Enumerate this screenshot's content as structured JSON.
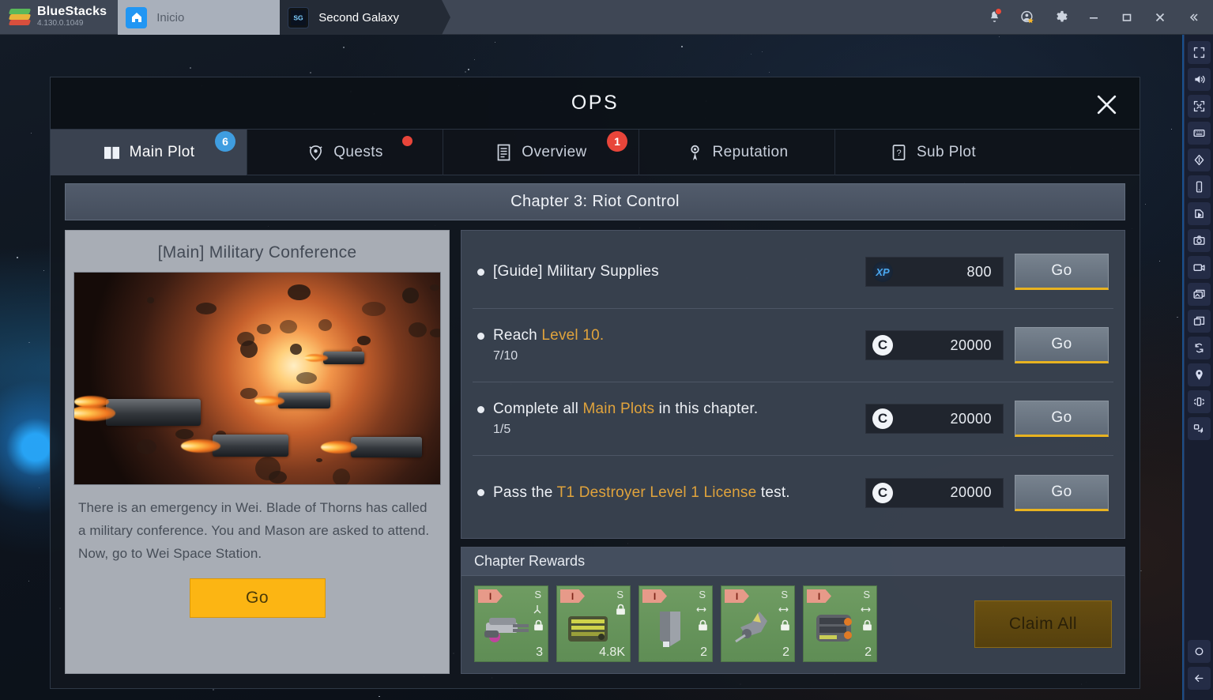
{
  "bluestacks": {
    "brand": "BlueStacks",
    "version": "4.130.0.1049",
    "tabs": [
      {
        "label": "Inicio",
        "icon": "home-icon",
        "active": false
      },
      {
        "label": "Second Galaxy",
        "icon": "game-app-icon",
        "active": true
      }
    ],
    "window_controls": [
      {
        "name": "notifications-bell-icon",
        "glyph": "🔔",
        "has_dot": true
      },
      {
        "name": "account-star-icon",
        "glyph": "★",
        "has_dot": false
      },
      {
        "name": "settings-gear-icon",
        "glyph": "⚙",
        "has_dot": false
      },
      {
        "name": "minimize-button",
        "glyph": "—",
        "has_dot": false
      },
      {
        "name": "maximize-button",
        "glyph": "❐",
        "has_dot": false
      },
      {
        "name": "close-button",
        "glyph": "✕",
        "has_dot": false
      },
      {
        "name": "collapse-button",
        "glyph": "«",
        "has_dot": false
      }
    ]
  },
  "modal": {
    "title": "OPS",
    "close_label": "✕",
    "chapter": "Chapter 3: Riot Control"
  },
  "tabs": [
    {
      "label": "Main Plot",
      "icon": "book-icon",
      "active": true,
      "badge": "6",
      "badge_type": "blue"
    },
    {
      "label": "Quests",
      "icon": "helmet-icon",
      "active": false,
      "badge": "",
      "badge_type": "dot"
    },
    {
      "label": "Overview",
      "icon": "document-icon",
      "active": false,
      "badge": "1",
      "badge_type": "red"
    },
    {
      "label": "Reputation",
      "icon": "medal-icon",
      "active": false,
      "badge": "",
      "badge_type": "none"
    },
    {
      "label": "Sub Plot",
      "icon": "question-icon",
      "active": false,
      "badge": "",
      "badge_type": "none"
    }
  ],
  "mission": {
    "title": "[Main] Military Conference",
    "description": "There is an emergency in Wei. Blade of Thorns has called a military conference. You and Mason are asked to attend. Now, go to Wei Space Station.",
    "go_label": "Go",
    "art_alt": "space-battle-artwork"
  },
  "tasks": [
    {
      "text_prefix": "[Guide] Military Supplies",
      "highlight": "",
      "text_suffix": "",
      "progress": "",
      "reward_icon": "xp",
      "reward_value": "800",
      "action": "Go"
    },
    {
      "text_prefix": "Reach ",
      "highlight": "Level 10.",
      "text_suffix": "",
      "progress": "7/10",
      "reward_icon": "c",
      "reward_value": "20000",
      "action": "Go"
    },
    {
      "text_prefix": "Complete all ",
      "highlight": "Main Plots",
      "text_suffix": " in this chapter.",
      "progress": "1/5",
      "reward_icon": "c",
      "reward_value": "20000",
      "action": "Go"
    },
    {
      "text_prefix": "Pass the ",
      "highlight": "T1 Destroyer Level 1 License",
      "text_suffix": " test.",
      "progress": "",
      "reward_icon": "c",
      "reward_value": "20000",
      "action": "Go"
    }
  ],
  "rewards": {
    "header": "Chapter Rewards",
    "claim_label": "Claim All",
    "items": [
      {
        "rank": "I",
        "grade": "S",
        "qty": "3",
        "locked": true,
        "sub_icon": "antenna-icon",
        "art": "weapon-turret"
      },
      {
        "rank": "I",
        "grade": "S",
        "qty": "4.8K",
        "locked": true,
        "sub_icon": "",
        "art": "ammo-crate"
      },
      {
        "rank": "I",
        "grade": "S",
        "qty": "2",
        "locked": true,
        "sub_icon": "shield-icon",
        "art": "armor-plate"
      },
      {
        "rank": "I",
        "grade": "S",
        "qty": "2",
        "locked": true,
        "sub_icon": "shield-icon",
        "art": "drone-module"
      },
      {
        "rank": "I",
        "grade": "S",
        "qty": "2",
        "locked": true,
        "sub_icon": "shield-icon",
        "art": "engine-module"
      }
    ]
  },
  "sidebar": {
    "items": [
      {
        "name": "fullscreen-icon"
      },
      {
        "name": "volume-icon"
      },
      {
        "name": "resize-icon"
      },
      {
        "name": "keyboard-icon"
      },
      {
        "name": "gamepad-icon"
      },
      {
        "name": "phone-rotate-icon"
      },
      {
        "name": "script-play-icon"
      },
      {
        "name": "screenshot-camera-icon"
      },
      {
        "name": "video-record-icon"
      },
      {
        "name": "media-manager-icon"
      },
      {
        "name": "multi-instance-icon"
      },
      {
        "name": "sync-icon"
      },
      {
        "name": "location-pin-icon"
      },
      {
        "name": "shake-icon"
      },
      {
        "name": "macro-icon"
      }
    ],
    "bottom": [
      {
        "name": "home-circle-icon"
      },
      {
        "name": "back-arrow-icon"
      }
    ]
  },
  "colors": {
    "accent_yellow": "#fcb513",
    "badge_blue": "#3f9de0",
    "badge_red": "#e8453a",
    "highlight_orange": "#e0a33c",
    "reward_green": "#5f8d55"
  }
}
